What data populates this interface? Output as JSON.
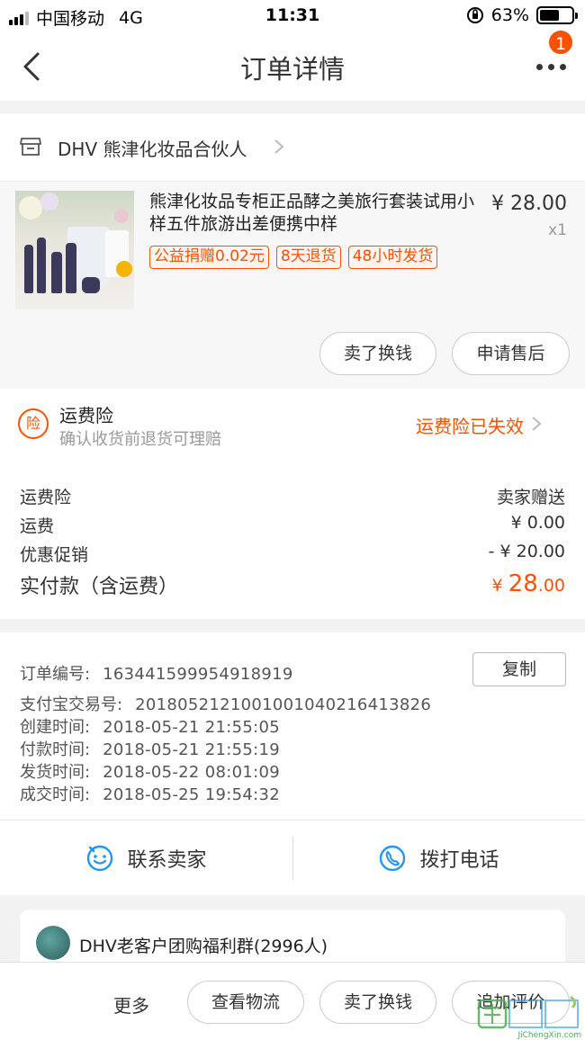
{
  "status_bar": {
    "carrier": "中国移动",
    "network": "4G",
    "time": "11:31",
    "battery_percent": "63%",
    "battery_level": 0.63
  },
  "nav": {
    "title": "订单详情",
    "badge_count": "1",
    "icons": [
      "back-chevron-icon",
      "more-dots-icon"
    ]
  },
  "shop": {
    "name": "DHV 熊津化妆品合伙人",
    "icon": "store-icon"
  },
  "product": {
    "title": "熊津化妆品专柜正品酵之美旅行套装试用小样五件旅游出差便携中样",
    "price": "¥ 28.00",
    "quantity": "x1",
    "tags": [
      "公益捐赠0.02元",
      "8天退货",
      "48小时发货"
    ],
    "buttons": {
      "sell": "卖了换钱",
      "after_sale": "申请售后"
    }
  },
  "insurance": {
    "icon_char": "险",
    "title": "运费险",
    "subtitle": "确认收货前退货可理赔",
    "status": "运费险已失效"
  },
  "fees": {
    "rows": [
      {
        "label": "运费险",
        "value": "卖家赠送"
      },
      {
        "label": "运费",
        "value": "¥ 0.00"
      },
      {
        "label": "优惠促销",
        "value": "- ¥ 20.00"
      }
    ],
    "total_label": "实付款（含运费）",
    "total_currency": "¥ ",
    "total_integer": "28",
    "total_decimal": ".00"
  },
  "order_info": {
    "copy_label": "复制",
    "lines": [
      {
        "label": "订单编号:",
        "value": "163441599954918919"
      },
      {
        "label": "支付宝交易号:",
        "value": "2018052121001001040216413826"
      },
      {
        "label": "创建时间:",
        "value": "2018-05-21 21:55:05"
      },
      {
        "label": "付款时间:",
        "value": "2018-05-21 21:55:19"
      },
      {
        "label": "发货时间:",
        "value": "2018-05-22 08:01:09"
      },
      {
        "label": "成交时间:",
        "value": "2018-05-25 19:54:32"
      }
    ]
  },
  "contact": {
    "seller": "联系卖家",
    "phone": "拨打电话"
  },
  "group": {
    "name": "DHV老客户团购福利群(2996人)"
  },
  "bottom": {
    "more": "更多",
    "logistics": "查看物流",
    "sell": "卖了换钱",
    "review": "追加评价"
  },
  "watermark": {
    "text": "JiChengXin.com"
  },
  "colors": {
    "accent": "#ff5000",
    "icon_blue": "#2196f3"
  }
}
